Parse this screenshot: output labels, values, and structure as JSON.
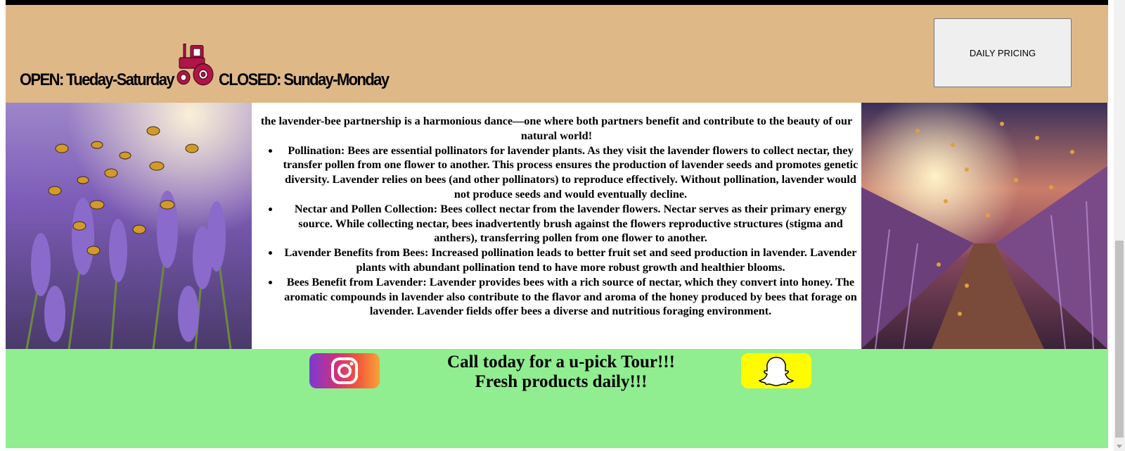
{
  "header": {
    "open_text": "OPEN: Tueday-Saturday",
    "closed_text": "CLOSED: Sunday-Monday",
    "pricing_button": "DAILY PRICING"
  },
  "article": {
    "intro": "the lavender-bee partnership is a harmonious dance—one where both partners benefit and contribute to the beauty of our natural world!",
    "items": [
      "Pollination: Bees are essential pollinators for lavender plants. As they visit the lavender flowers to collect nectar, they transfer pollen from one flower to another. This process ensures the production of lavender seeds and promotes genetic diversity. Lavender relies on bees (and other pollinators) to reproduce effectively. Without pollination, lavender would not produce seeds and would eventually decline.",
      "Nectar and Pollen Collection: Bees collect nectar from the lavender flowers. Nectar serves as their primary energy source. While collecting nectar, bees inadvertently brush against the flowers reproductive structures (stigma and anthers), transferring pollen from one flower to another.",
      "Lavender Benefits from Bees: Increased pollination leads to better fruit set and seed production in lavender. Lavender plants with abundant pollination tend to have more robust growth and healthier blooms.",
      "Bees Benefit from Lavender: Lavender provides bees with a rich source of nectar, which they convert into honey. The aromatic compounds in lavender also contribute to the flavor and aroma of the honey produced by bees that forage on lavender. Lavender fields offer bees a diverse and nutritious foraging environment."
    ]
  },
  "footer": {
    "cta_line1": "Call today for a u-pick Tour!!!",
    "cta_line2": "Fresh products daily!!!"
  },
  "icons": {
    "tractor": "tractor-icon",
    "instagram": "instagram-icon",
    "snapchat": "snapchat-icon"
  },
  "colors": {
    "header_bg": "#deb887",
    "footer_bg": "#90ee90",
    "tractor": "#b01547"
  }
}
